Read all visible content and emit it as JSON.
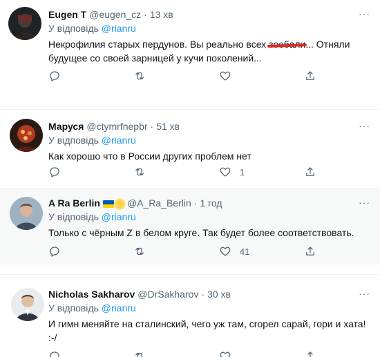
{
  "common": {
    "reply_prefix": "У відповідь",
    "mention": "@rianru",
    "dot": "·",
    "more": "···"
  },
  "tweets": [
    {
      "name": "Eugen T",
      "handle": "@eugen_cz",
      "time": "13 хв",
      "text_before": "Некрофилия старых пердунов. Вы реально всех ",
      "text_struck": "зоебали",
      "text_after": "... Отняли\nбудущее со своей зарницей у кучи поколений...",
      "likes": ""
    },
    {
      "name": "Маруся",
      "handle": "@ctymrfnepbr",
      "time": "51 хв",
      "text": "Как хорошо что в России других проблем нет",
      "likes": "1"
    },
    {
      "name": "A Ra Berlin",
      "handle": "@A_Ra_Berlin",
      "time": "1 год",
      "text": "Только с чёрным Z в белом круге. Так будет более соответствовать.",
      "likes": "41"
    },
    {
      "name": "Nicholas Sakharov",
      "handle": "@DrSakharov",
      "time": "30 хв",
      "text": "И гимн меняйте на сталинский, чего уж там, сгорел сарай, гори и хата!\n:-/",
      "likes": ""
    }
  ]
}
